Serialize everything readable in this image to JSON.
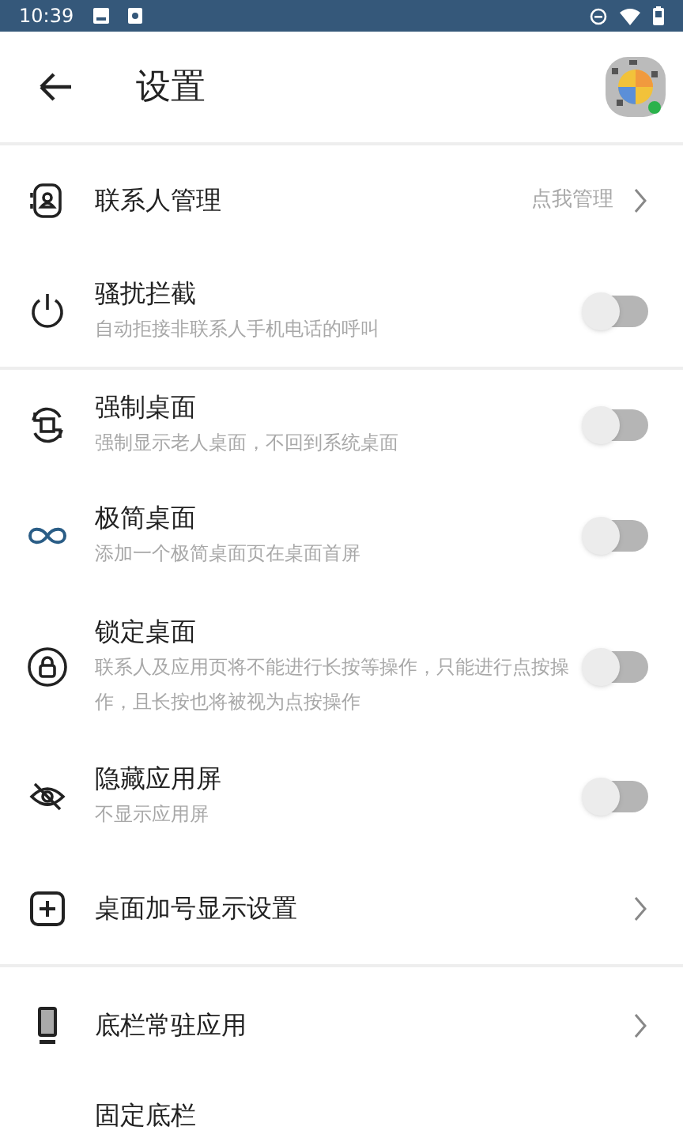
{
  "status_bar": {
    "time": "10:39"
  },
  "header": {
    "title": "设置"
  },
  "items": [
    {
      "kind": "link",
      "title": "联系人管理",
      "value": "点我管理",
      "divider": false
    },
    {
      "kind": "toggle",
      "title": "骚扰拦截",
      "subtitle": "自动拒接非联系人手机电话的呼叫",
      "on": false,
      "divider": true
    },
    {
      "kind": "toggle",
      "title": "强制桌面",
      "subtitle": "强制显示老人桌面，不回到系统桌面",
      "on": false,
      "divider": false
    },
    {
      "kind": "toggle",
      "title": "极简桌面",
      "subtitle": "添加一个极简桌面页在桌面首屏",
      "on": false,
      "divider": false
    },
    {
      "kind": "toggle",
      "title": "锁定桌面",
      "subtitle": "联系人及应用页将不能进行长按等操作，只能进行点按操作，且长按也将被视为点按操作",
      "on": false,
      "divider": false
    },
    {
      "kind": "toggle",
      "title": "隐藏应用屏",
      "subtitle": "不显示应用屏",
      "on": false,
      "divider": false
    },
    {
      "kind": "nav",
      "title": "桌面加号显示设置",
      "divider": true
    },
    {
      "kind": "nav",
      "title": "底栏常驻应用",
      "divider": false
    },
    {
      "kind": "plain",
      "title": "固定底栏",
      "divider": false
    }
  ]
}
